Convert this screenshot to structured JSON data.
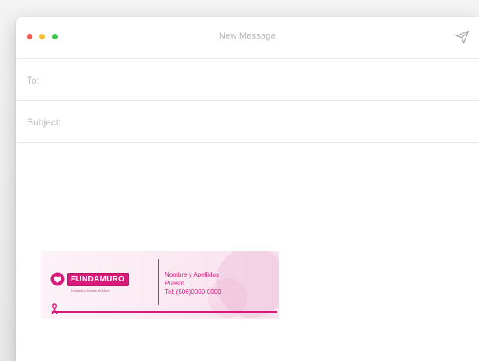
{
  "window": {
    "title": "New Message"
  },
  "colors": {
    "close": "#f15e57",
    "minimize": "#f7be38",
    "zoom": "#3ec84d",
    "brand": "#d81b7a"
  },
  "icons": {
    "send": "paper-plane-icon"
  },
  "compose": {
    "to_label": "To:",
    "to_value": "",
    "subject_label": "Subject:",
    "subject_value": ""
  },
  "signature": {
    "logo_text": "FUNDAMURO",
    "logo_tagline": "Fundación Amigos de Muro",
    "name": "Nombre y Apellidos",
    "role": "Puesto",
    "phone": "Tel: (506)0000-0000"
  }
}
